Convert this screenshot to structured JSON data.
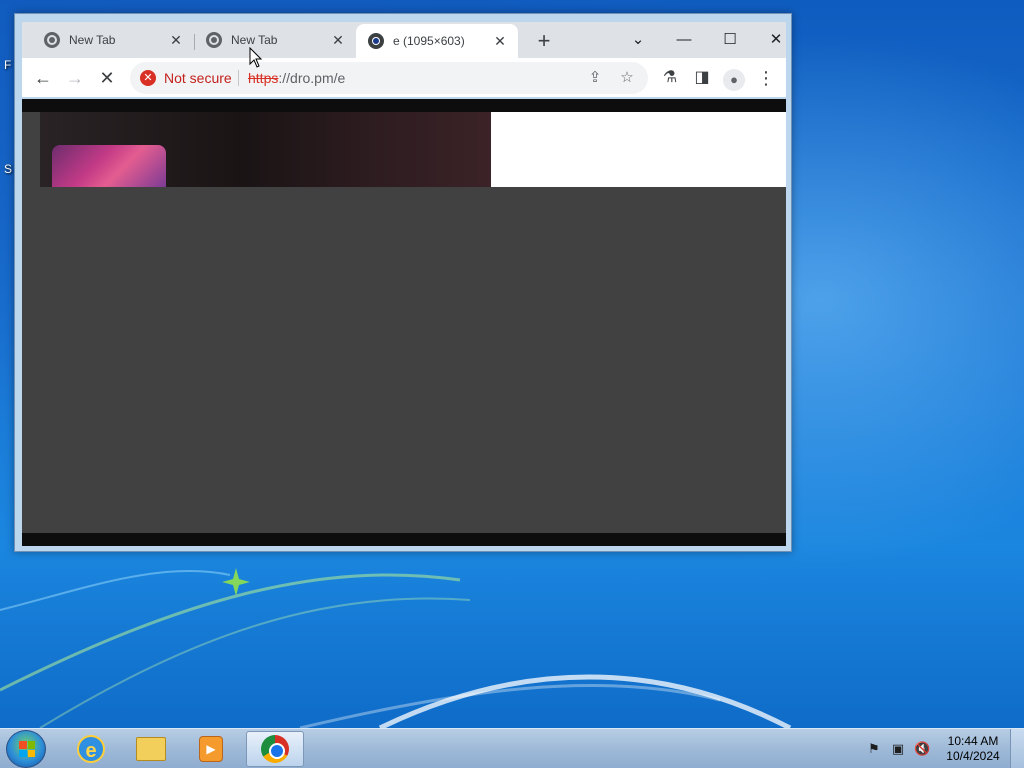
{
  "desktop": {
    "icon_labels": [
      "F",
      "S"
    ]
  },
  "browser": {
    "tabs": [
      {
        "title": "New Tab",
        "icon": "chrome-globe-icon",
        "active": false
      },
      {
        "title": "New Tab",
        "icon": "chrome-globe-icon",
        "active": false
      },
      {
        "title": "e (1095×603)",
        "icon": "loading-favicon-icon",
        "active": true
      }
    ],
    "new_tab_label": "+",
    "window_controls": {
      "tab_search": "⌄",
      "minimize": "—",
      "maximize": "☐",
      "close": "✕"
    },
    "toolbar": {
      "back": "←",
      "forward": "→",
      "stop": "✕"
    },
    "omnibox": {
      "security_label": "Not secure",
      "url_scheme": "https",
      "url_rest": "://dro.pm/e"
    }
  },
  "taskbar": {
    "apps": [
      {
        "name": "Internet Explorer",
        "icon": "ie-icon"
      },
      {
        "name": "Windows Explorer",
        "icon": "folder-icon"
      },
      {
        "name": "Windows Media Player",
        "icon": "media-player-icon"
      },
      {
        "name": "Google Chrome",
        "icon": "chrome-icon",
        "active": true
      }
    ],
    "clock": {
      "time": "10:44 AM",
      "date": "10/4/2024"
    }
  },
  "colors": {
    "insecure_red": "#d93025",
    "content_bg": "#414141",
    "tabstrip_bg": "#dee1e6"
  }
}
